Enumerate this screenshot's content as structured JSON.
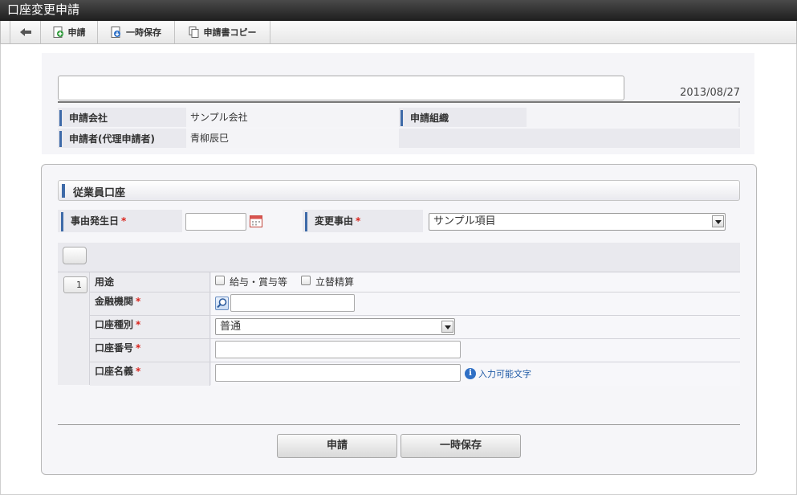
{
  "window": {
    "title": "口座変更申請"
  },
  "toolbar": {
    "back_icon": "back-arrow-icon",
    "apply_label": "申請",
    "save_label": "一時保存",
    "copy_label": "申請書コピー"
  },
  "header": {
    "title_value": "",
    "date": "2013/08/27"
  },
  "info": {
    "company_label": "申請会社",
    "company_value": "サンプル会社",
    "org_label": "申請組織",
    "org_value": "",
    "applicant_label": "申請者(代理申請者)",
    "applicant_value": "青柳辰巳"
  },
  "section": {
    "title": "従業員口座",
    "event_date_label": "事由発生日",
    "event_date_value": "",
    "reason_label": "変更事由",
    "reason_value": "サンプル項目",
    "required_mark": "*"
  },
  "accounts": {
    "row_index": "1",
    "purpose_label": "用途",
    "purpose_options": [
      "給与・賞与等",
      "立替精算"
    ],
    "bank_label": "金融機関",
    "bank_value": "",
    "type_label": "口座種別",
    "type_value": "普通",
    "number_label": "口座番号",
    "number_value": "",
    "holder_label": "口座名義",
    "holder_value": "",
    "input_chars_link": "入力可能文字"
  },
  "buttons": {
    "apply": "申請",
    "save": "一時保存"
  },
  "colors": {
    "accent": "#3e6aa8",
    "required": "#d9241c",
    "link": "#1f5aa6"
  }
}
